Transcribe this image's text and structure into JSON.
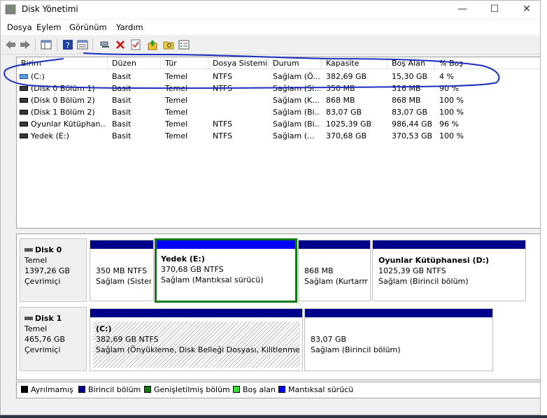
{
  "window": {
    "title": "Disk Yönetimi",
    "minimize": "—",
    "maximize": "☐",
    "close": "✕"
  },
  "menu": [
    "Dosya",
    "Eylem",
    "Görünüm",
    "Yardım"
  ],
  "columns": [
    "Birim",
    "Düzen",
    "Tür",
    "Dosya Sistemi",
    "Durum",
    "Kapasite",
    "Boş Alan",
    "% Boş"
  ],
  "volumes": [
    {
      "name": "(C:)",
      "layout": "Basit",
      "type": "Temel",
      "fs": "NTFS",
      "status": "Sağlam (Ö...",
      "capacity": "382,69 GB",
      "free": "15,30 GB",
      "pct": "4 %",
      "icon": "drive-c-icon"
    },
    {
      "name": "(Disk 0 Bölüm 1)",
      "layout": "Basit",
      "type": "Temel",
      "fs": "NTFS",
      "status": "Sağlam (Si...",
      "capacity": "350 MB",
      "free": "316 MB",
      "pct": "90 %",
      "icon": "drive-icon"
    },
    {
      "name": "(Disk 0 Bölüm 2)",
      "layout": "Basit",
      "type": "Temel",
      "fs": "",
      "status": "Sağlam (K...",
      "capacity": "868 MB",
      "free": "868 MB",
      "pct": "100 %",
      "icon": "drive-icon"
    },
    {
      "name": "(Disk 1 Bölüm 2)",
      "layout": "Basit",
      "type": "Temel",
      "fs": "",
      "status": "Sağlam (Bi...",
      "capacity": "83,07 GB",
      "free": "83,07 GB",
      "pct": "100 %",
      "icon": "drive-icon"
    },
    {
      "name": "Oyunlar Kütüphan...",
      "layout": "Basit",
      "type": "Temel",
      "fs": "NTFS",
      "status": "Sağlam (Bi...",
      "capacity": "1025,39 GB",
      "free": "986,44 GB",
      "pct": "96 %",
      "icon": "drive-icon"
    },
    {
      "name": "Yedek (E:)",
      "layout": "Basit",
      "type": "Temel",
      "fs": "NTFS",
      "status": "Sağlam (...",
      "capacity": "370,68 GB",
      "free": "370,53 GB",
      "pct": "100 %",
      "icon": "drive-icon"
    }
  ],
  "disks": [
    {
      "name": "Disk 0",
      "kind": "Temel",
      "size": "1397,26 GB",
      "state": "Çevrimiçi",
      "partitions": [
        {
          "title": "",
          "size": "350 MB NTFS",
          "status": "Sağlam (Sistem"
        },
        {
          "title": "Yedek  (E:)",
          "size": "370,68 GB NTFS",
          "status": "Sağlam (Mantıksal sürücü)"
        },
        {
          "title": "",
          "size": "868 MB",
          "status": "Sağlam (Kurtarma"
        },
        {
          "title": "Oyunlar Kütüphanesi  (D:)",
          "size": "1025,39 GB NTFS",
          "status": "Sağlam (Birincil bölüm)"
        }
      ]
    },
    {
      "name": "Disk 1",
      "kind": "Temel",
      "size": "465,76 GB",
      "state": "Çevrimiçi",
      "partitions": [
        {
          "title": "(C:)",
          "size": "382,69 GB NTFS",
          "status": "Sağlam (Önyükleme, Disk Belleği Dosyası, Kilitlenme Bil"
        },
        {
          "title": "",
          "size": "83,07 GB",
          "status": "Sağlam (Birincil bölüm)"
        }
      ]
    }
  ],
  "legend": [
    {
      "label": "Ayrılmamış",
      "color": "#000000"
    },
    {
      "label": "Birincil bölüm",
      "color": "#00008b"
    },
    {
      "label": "Genişletilmiş bölüm",
      "color": "#0e7a0e"
    },
    {
      "label": "Boş alan",
      "color": "#33dd33"
    },
    {
      "label": "Mantıksal sürücü",
      "color": "#0000ff"
    }
  ],
  "annotation_color": "#1a2fbf"
}
